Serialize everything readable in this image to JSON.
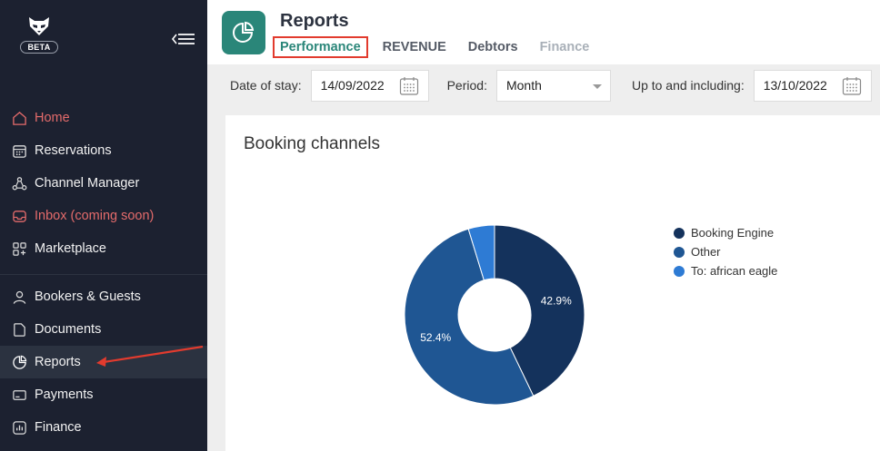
{
  "app": {
    "badge": "BETA"
  },
  "sidebar": {
    "items_top": [
      {
        "label": "Home",
        "icon": "home-icon",
        "color": "red"
      },
      {
        "label": "Reservations",
        "icon": "calendar-icon",
        "color": "white"
      },
      {
        "label": "Channel Manager",
        "icon": "network-icon",
        "color": "white"
      },
      {
        "label": "Inbox (coming soon)",
        "icon": "inbox-icon",
        "color": "red"
      },
      {
        "label": "Marketplace",
        "icon": "apps-icon",
        "color": "white"
      }
    ],
    "items_bottom": [
      {
        "label": "Bookers & Guests",
        "icon": "user-icon"
      },
      {
        "label": "Documents",
        "icon": "document-icon"
      },
      {
        "label": "Reports",
        "icon": "pie-icon",
        "active": true
      },
      {
        "label": "Payments",
        "icon": "card-icon"
      },
      {
        "label": "Finance",
        "icon": "finance-icon"
      }
    ]
  },
  "header": {
    "title": "Reports",
    "tabs": [
      {
        "label": "Performance",
        "state": "active"
      },
      {
        "label": "REVENUE",
        "state": "normal"
      },
      {
        "label": "Debtors",
        "state": "normal"
      },
      {
        "label": "Finance",
        "state": "muted"
      }
    ]
  },
  "filters": {
    "date_of_stay_label": "Date of stay:",
    "date_of_stay_value": "14/09/2022",
    "period_label": "Period:",
    "period_value": "Month",
    "up_to_label": "Up to and including:",
    "up_to_value": "13/10/2022"
  },
  "card": {
    "title": "Booking channels"
  },
  "chart_data": {
    "type": "pie",
    "donut": true,
    "title": "Booking channels",
    "legend_position": "right",
    "series": [
      {
        "name": "Booking Engine",
        "value": 42.9,
        "label": "42.9%",
        "color": "#14325c"
      },
      {
        "name": "Other",
        "value": 52.4,
        "label": "52.4%",
        "color": "#1f5693"
      },
      {
        "name": "To: african eagle",
        "value": 4.7,
        "label": "",
        "color": "#2e7bd4"
      }
    ]
  },
  "colors": {
    "accent": "#2a8679",
    "sidebar_bg": "#1c2130",
    "highlight_red": "#e23b2e"
  }
}
